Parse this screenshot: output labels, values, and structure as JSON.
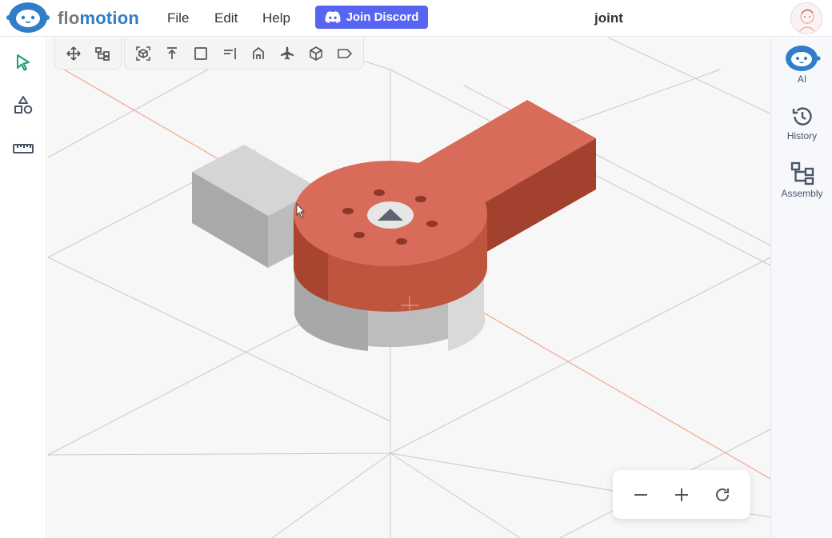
{
  "app": {
    "brand_prefix": "flo",
    "brand_suffix": "motion",
    "doc_title": "joint"
  },
  "menu": [
    "File",
    "Edit",
    "Help"
  ],
  "discord": {
    "label": "Join Discord"
  },
  "left_tools": [
    "select-cursor-icon",
    "shapes-icon",
    "ruler-icon"
  ],
  "view_toolbar": {
    "group1": [
      "move-icon",
      "hierarchy-icon"
    ],
    "group2": [
      "fit-view-icon",
      "view-top-icon",
      "view-front-icon",
      "view-right-icon",
      "view-home-icon",
      "view-plane-icon",
      "view-isometric-icon",
      "tag-icon"
    ]
  },
  "right_panel": [
    {
      "id": "ai",
      "label": "AI",
      "icon": "robot-icon"
    },
    {
      "id": "history",
      "label": "History",
      "icon": "history-icon"
    },
    {
      "id": "assembly",
      "label": "Assembly",
      "icon": "assembly-icon"
    }
  ],
  "zoom_controls": [
    "zoom-out-icon",
    "zoom-in-icon",
    "reset-view-icon"
  ],
  "colors": {
    "accent": "#2f7ec7",
    "discord": "#5865f2",
    "part_red": "#d86b59",
    "part_grey": "#c9c9c9",
    "cursor_green": "#1a9e6a"
  }
}
